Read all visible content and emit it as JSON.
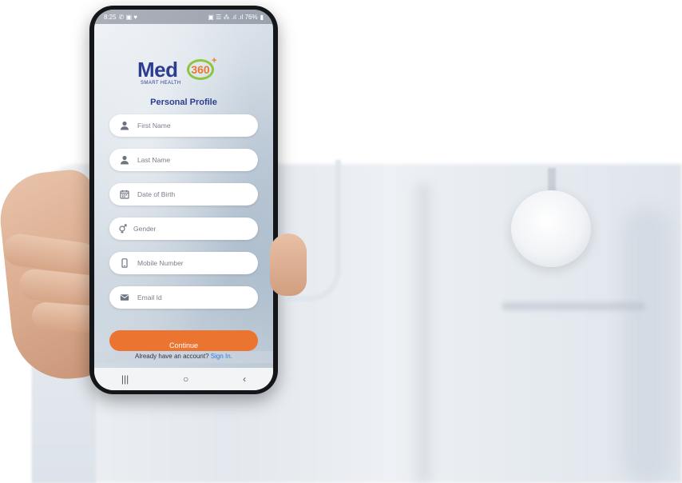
{
  "status_bar": {
    "time": "8:25",
    "left_icons": "✆ ▣ ♥",
    "right_text": "▣ ☰ ⁂ .ıl .ıl 76%",
    "battery_icon": "battery-icon"
  },
  "logo": {
    "name": "Med",
    "number": "360",
    "plus": "+",
    "tagline": "SMART HEALTH"
  },
  "form": {
    "title": "Personal Profile",
    "fields": [
      {
        "placeholder": "First Name",
        "icon": "person-icon"
      },
      {
        "placeholder": "Last Name",
        "icon": "person-icon"
      },
      {
        "placeholder": "Date of Birth",
        "icon": "calendar-icon"
      },
      {
        "placeholder": "Gender",
        "icon": "gender-icon"
      },
      {
        "placeholder": "Mobile Number",
        "icon": "mobile-icon"
      },
      {
        "placeholder": "Email Id",
        "icon": "mail-icon"
      }
    ],
    "continue_label": "Continue",
    "signin_prompt": "Already have an account?",
    "signin_link": "Sign In."
  },
  "nav": {
    "recents": "|||",
    "home": "○",
    "back": "‹"
  },
  "colors": {
    "brand_blue": "#2b3e8f",
    "accent_orange": "#ec7431",
    "ring_green": "#8cc63f",
    "link_blue": "#2f7be0"
  }
}
